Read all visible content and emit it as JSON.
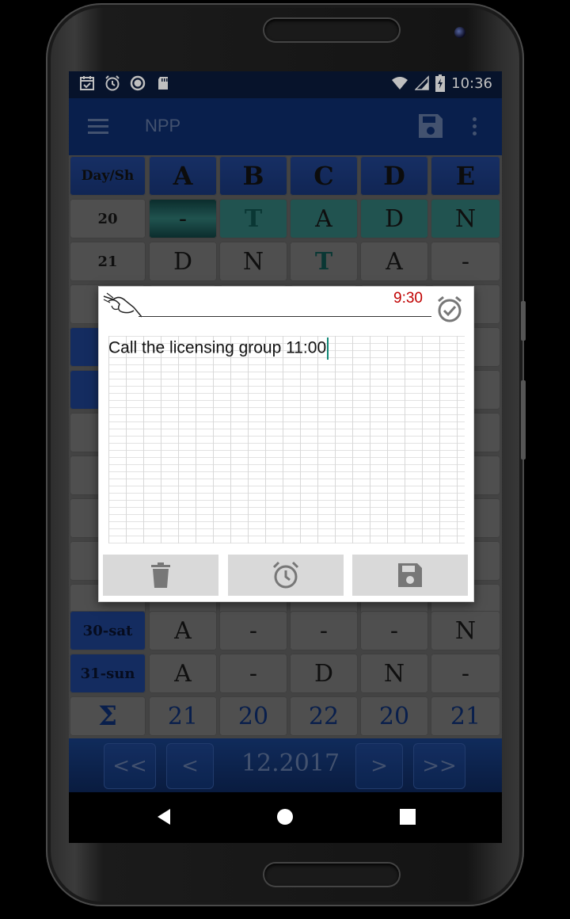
{
  "status_bar": {
    "time": "10:36",
    "icons_left": [
      "calendar-check-icon",
      "alarm-icon",
      "sync-circle-icon",
      "sd-card-icon"
    ],
    "icons_right": [
      "wifi-icon",
      "signal-icon",
      "battery-charging-icon"
    ]
  },
  "app_bar": {
    "title": "NPP",
    "icons": [
      "menu-icon",
      "save-icon",
      "more-vert-icon"
    ]
  },
  "schedule": {
    "header": [
      "Day/Sh",
      "A",
      "B",
      "C",
      "D",
      "E"
    ],
    "rows": [
      {
        "day": "20",
        "cells": [
          "-",
          "T",
          "A",
          "D",
          "N"
        ]
      },
      {
        "day": "21",
        "cells": [
          "D",
          "N",
          "T",
          "A",
          "-"
        ]
      },
      {
        "day": "30-sat",
        "cells": [
          "A",
          "-",
          "-",
          "-",
          "N"
        ]
      },
      {
        "day": "31-sun",
        "cells": [
          "A",
          "-",
          "D",
          "N",
          "-"
        ]
      }
    ],
    "sum_label": "Σ",
    "sums": [
      "21",
      "20",
      "22",
      "20",
      "21"
    ]
  },
  "footer": {
    "first_label": "<<",
    "prev_label": "<",
    "month": "12.2017",
    "next_label": ">",
    "last_label": ">>"
  },
  "note_dialog": {
    "alarm_time": "9:30",
    "text": "Call the licensing group 11:00",
    "buttons": [
      "delete-icon",
      "alarm-icon",
      "save-icon"
    ]
  },
  "colors": {
    "app_bar": "#0d2a66",
    "alarm_time": "#c00000",
    "teal_cell": "#2c6f6b"
  }
}
